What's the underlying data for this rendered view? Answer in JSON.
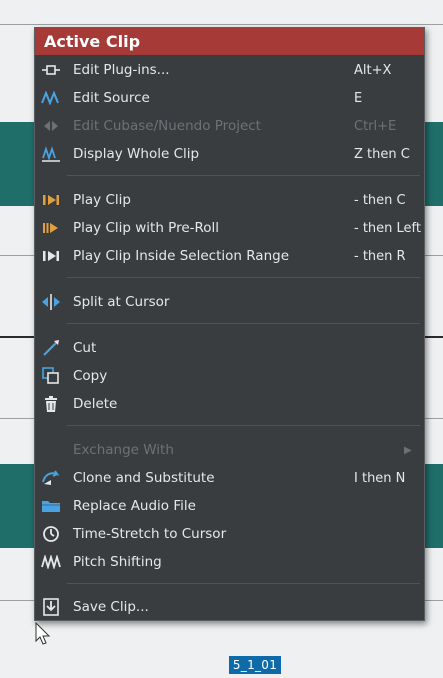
{
  "menu": {
    "title": "Active Clip",
    "items": [
      {
        "label": "Edit Plug-ins...",
        "shortcut": "Alt+X",
        "icon": "plugin-icon"
      },
      {
        "label": "Edit Source",
        "shortcut": "E",
        "icon": "waveform-icon"
      },
      {
        "label": "Edit Cubase/Nuendo Project",
        "shortcut": "Ctrl+E",
        "icon": "project-icon",
        "disabled": true
      },
      {
        "label": "Display Whole Clip",
        "shortcut": "Z then C",
        "icon": "display-clip-icon"
      },
      {
        "label": "Play Clip",
        "shortcut": "- then C",
        "icon": "play-clip-icon"
      },
      {
        "label": "Play Clip with Pre-Roll",
        "shortcut": "- then Left",
        "icon": "play-preroll-icon"
      },
      {
        "label": "Play Clip Inside Selection Range",
        "shortcut": "- then R",
        "icon": "play-range-icon"
      },
      {
        "label": "Split at Cursor",
        "shortcut": "",
        "icon": "split-icon"
      },
      {
        "label": "Cut",
        "shortcut": "",
        "icon": "cut-icon"
      },
      {
        "label": "Copy",
        "shortcut": "",
        "icon": "copy-icon"
      },
      {
        "label": "Delete",
        "shortcut": "",
        "icon": "trash-icon"
      },
      {
        "label": "Exchange With",
        "shortcut": "",
        "icon": "",
        "disabled": true,
        "submenu": true
      },
      {
        "label": "Clone and Substitute",
        "shortcut": "I then N",
        "icon": "clone-icon"
      },
      {
        "label": "Replace Audio File",
        "shortcut": "",
        "icon": "folder-icon"
      },
      {
        "label": "Time-Stretch to Cursor",
        "shortcut": "",
        "icon": "time-stretch-icon"
      },
      {
        "label": "Pitch Shifting",
        "shortcut": "",
        "icon": "pitch-icon"
      },
      {
        "label": "Save Clip...",
        "shortcut": "",
        "icon": "save-icon"
      }
    ]
  },
  "timeline": {
    "marker_label": "5_1_01"
  },
  "colors": {
    "header": "#a63a36",
    "menu_bg": "#3a3d40",
    "track": "#1f6e6a",
    "accent_icon": "#4aa3e0",
    "orange_icon": "#e0a040"
  }
}
